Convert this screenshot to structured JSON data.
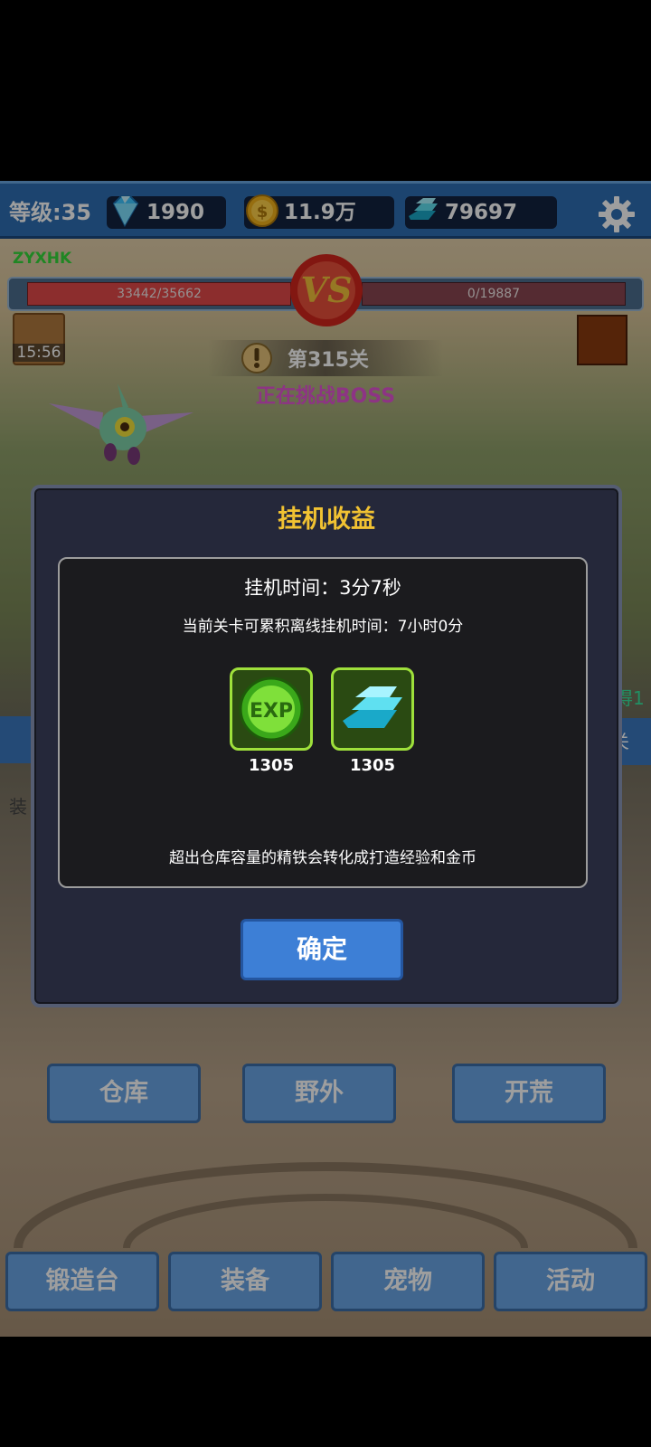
{
  "topbar": {
    "level": "等级:35",
    "diamonds": "1990",
    "gold": "11.9万",
    "iron": "79697",
    "icons": [
      "diamond-icon",
      "gold-coin-icon",
      "iron-ingot-icon",
      "gear-icon"
    ]
  },
  "battle": {
    "player_name": "ZYXHK",
    "player_hp": "33442/35662",
    "boss_hp": "0/19887",
    "timer": "15:56",
    "stage": "第315关",
    "status": "正在挑战BOSS"
  },
  "side": {
    "left_label": "装",
    "right_label": "关",
    "right_green": "得1"
  },
  "buttons_mid": [
    "仓库",
    "野外",
    "开荒"
  ],
  "buttons_bottom": [
    "锻造台",
    "装备",
    "宠物",
    "活动"
  ],
  "dialog": {
    "title": "挂机收益",
    "afk_time": "挂机时间：3分7秒",
    "afk_limit": "当前关卡可累积离线挂机时间：7小时0分",
    "rewards": [
      {
        "icon": "exp-orb-icon",
        "value": "1305"
      },
      {
        "icon": "iron-ingot-icon",
        "value": "1305"
      }
    ],
    "note": "超出仓库容量的精铁会转化成打造经验和金币",
    "confirm": "确定"
  },
  "colors": {
    "topbar": "#2e6fb3",
    "title_gold": "#f1c232",
    "status_pink": "#e455d6",
    "player_green": "#35d93a",
    "hp_red": "#e34a4a",
    "reward_border": "#9ee03b",
    "button_blue": "#3d7fd6"
  }
}
